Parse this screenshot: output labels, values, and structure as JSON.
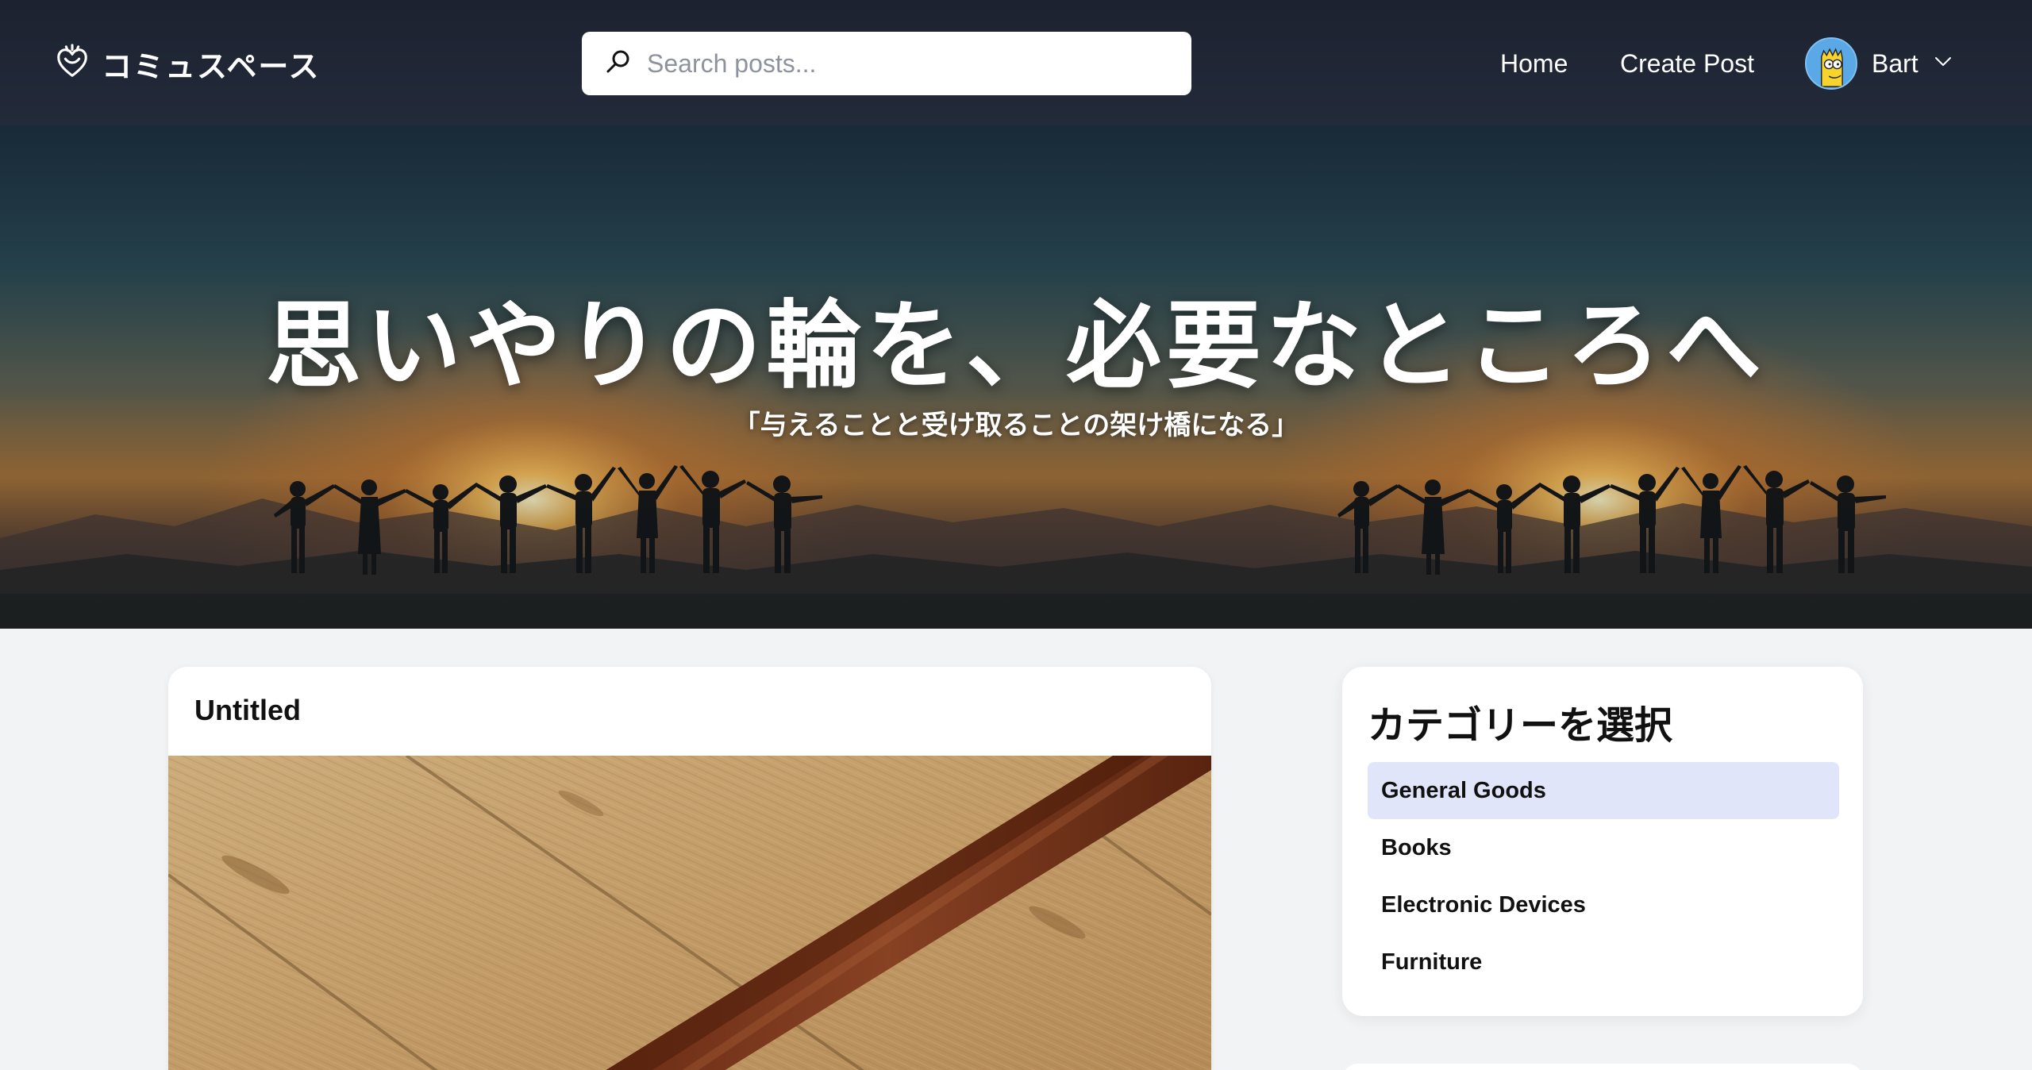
{
  "header": {
    "brand_name": "コミュスペース",
    "search": {
      "placeholder": "Search posts...",
      "value": ""
    },
    "nav": {
      "home_label": "Home",
      "create_post_label": "Create Post"
    },
    "user": {
      "name": "Bart"
    },
    "icons": {
      "logo": "heart-hands-icon",
      "search": "search-icon",
      "caret": "chevron-down-icon"
    }
  },
  "hero": {
    "title": "思いやりの輪を、必要なところへ",
    "subtitle": "「与えることと受け取ることの架け橋になる」"
  },
  "post": {
    "title": "Untitled"
  },
  "categories": {
    "title": "カテゴリーを選択",
    "items": [
      {
        "label": "General Goods",
        "active": true
      },
      {
        "label": "Books",
        "active": false
      },
      {
        "label": "Electronic Devices",
        "active": false
      },
      {
        "label": "Furniture",
        "active": false
      }
    ]
  },
  "colors": {
    "header_bg": "#1c2230",
    "page_bg": "#f1f3f5",
    "active_category_bg": "#e0e5fa"
  }
}
